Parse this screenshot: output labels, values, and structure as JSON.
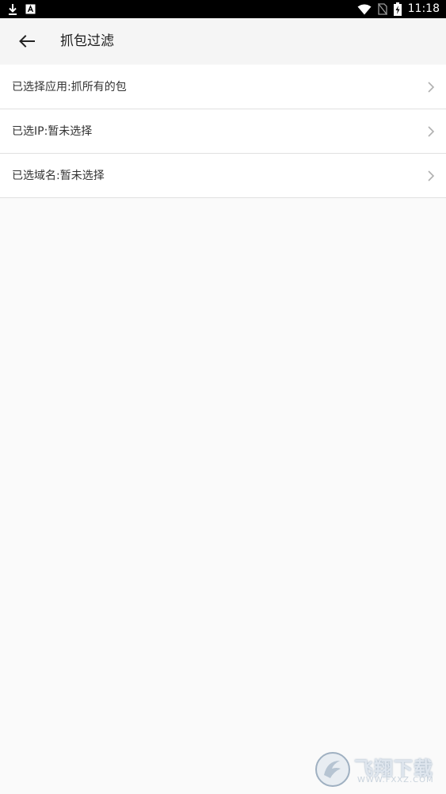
{
  "status_bar": {
    "time": "11:18",
    "left_icons": [
      "download-icon",
      "notification-a-icon"
    ],
    "right_icons": [
      "wifi-icon",
      "no-sim-icon",
      "battery-charging-icon"
    ]
  },
  "app_bar": {
    "back_icon": "arrow-left-icon",
    "title": "抓包过滤"
  },
  "filters": [
    {
      "label": "已选择应用:抓所有的包"
    },
    {
      "label": "已选IP:暂未选择"
    },
    {
      "label": "已选域名:暂未选择"
    }
  ],
  "watermark": {
    "brand": "飞翔下载",
    "url": "WWW.FXXZ.COM"
  },
  "colors": {
    "status_bar_bg": "#000000",
    "app_bar_bg": "#f5f5f5",
    "list_bg": "#ffffff",
    "page_bg": "#fafafa",
    "divider": "#e0e0e0"
  }
}
